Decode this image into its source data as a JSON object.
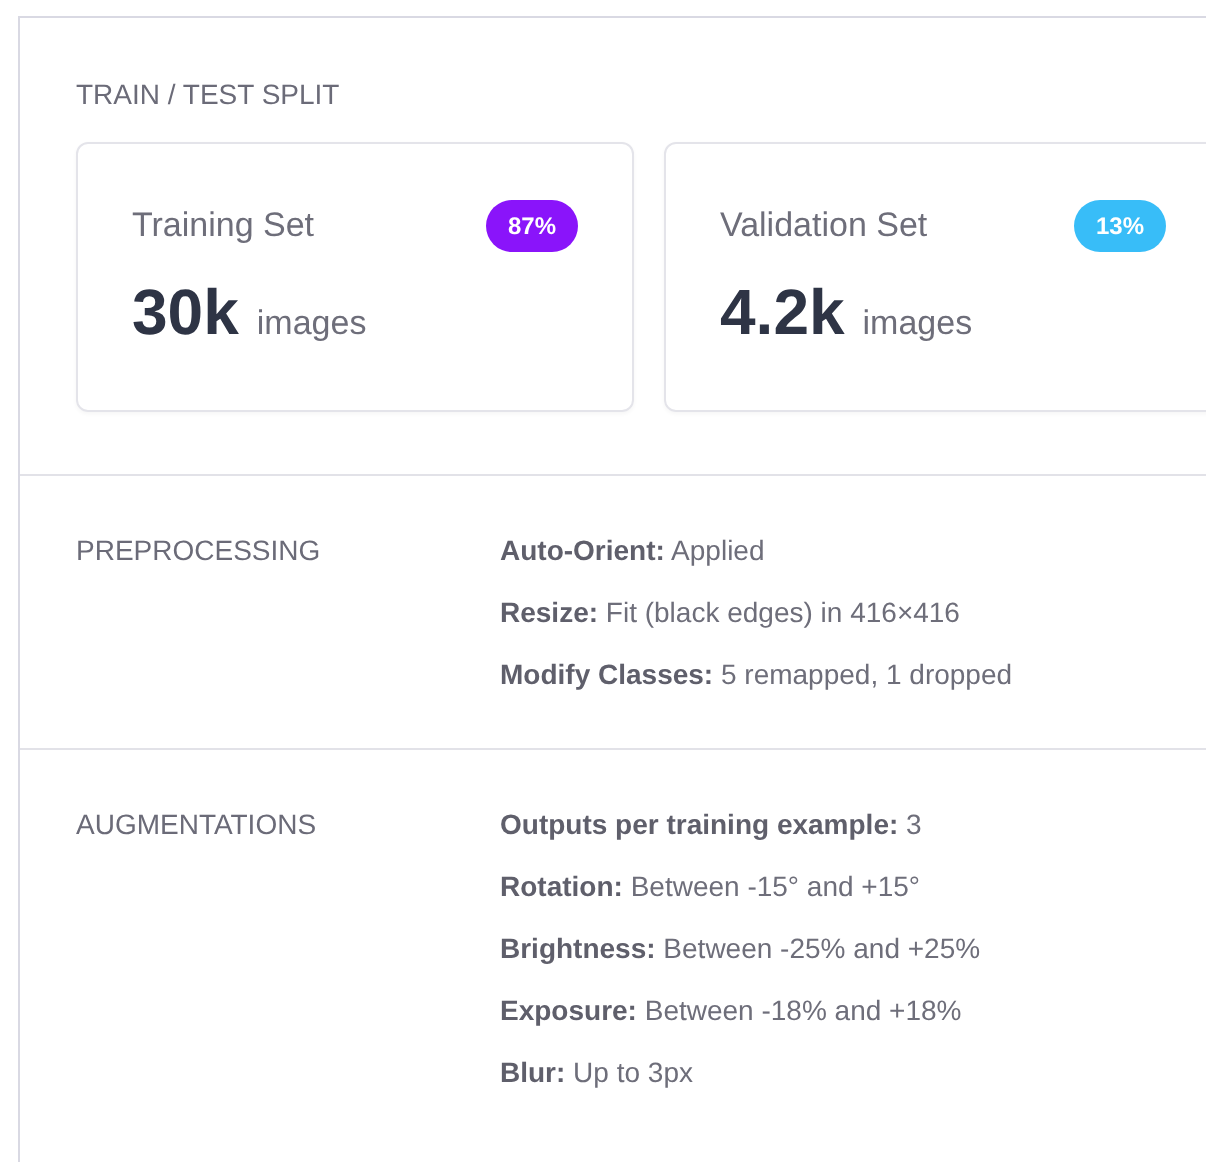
{
  "split": {
    "heading": "TRAIN / TEST SPLIT",
    "cards": [
      {
        "title": "Training Set",
        "badge": "87%",
        "color": "#8a14fa",
        "value": "30k",
        "unit": "images"
      },
      {
        "title": "Validation Set",
        "badge": "13%",
        "color": "#38bdf8",
        "value": "4.2k",
        "unit": "images"
      }
    ]
  },
  "sections": [
    {
      "heading": "PREPROCESSING",
      "items": [
        {
          "label": "Auto-Orient:",
          "value": "Applied"
        },
        {
          "label": "Resize:",
          "value": "Fit (black edges) in 416×416"
        },
        {
          "label": "Modify Classes:",
          "value": "5 remapped, 1 dropped"
        }
      ]
    },
    {
      "heading": "AUGMENTATIONS",
      "items": [
        {
          "label": "Outputs per training example:",
          "value": "3"
        },
        {
          "label": "Rotation:",
          "value": "Between -15° and +15°"
        },
        {
          "label": "Brightness:",
          "value": "Between -25% and +25%"
        },
        {
          "label": "Exposure:",
          "value": "Between -18% and +18%"
        },
        {
          "label": "Blur:",
          "value": "Up to 3px"
        }
      ]
    }
  ]
}
